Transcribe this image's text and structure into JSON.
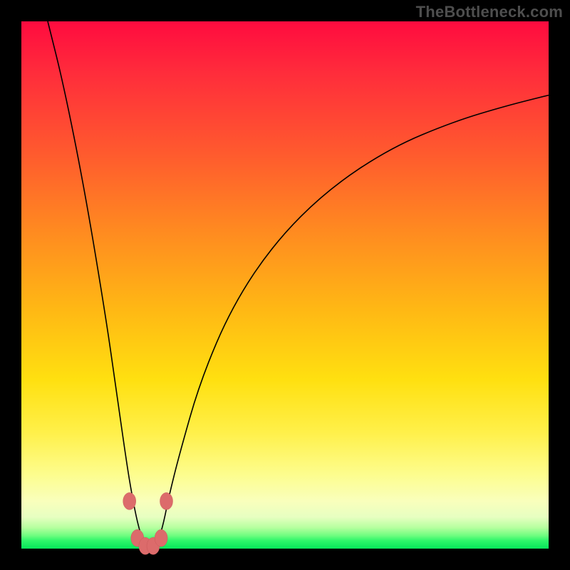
{
  "watermark": "TheBottleneck.com",
  "colors": {
    "frame": "#000000",
    "curve": "#000000",
    "marker": "#dc6b6b",
    "gradient_top": "#ff0b3f",
    "gradient_bottom": "#06e65a"
  },
  "chart_data": {
    "type": "line",
    "title": "",
    "xlabel": "",
    "ylabel": "",
    "xlim": [
      0,
      100
    ],
    "ylim": [
      0,
      100
    ],
    "note": "V-shaped bottleneck curve. y≈0 near optimum at x≈24; rises steeply on both sides. Background gradient: red (high bottleneck) at top → green (low) at bottom.",
    "series": [
      {
        "name": "bottleneck-curve",
        "x": [
          5,
          8,
          12,
          16,
          18,
          20,
          21,
          22,
          23,
          24,
          25,
          26,
          27,
          28,
          30,
          34,
          40,
          48,
          58,
          70,
          82,
          92,
          100
        ],
        "y": [
          100,
          88,
          68,
          44,
          30,
          16,
          10,
          5,
          1.5,
          0,
          0,
          1.5,
          5,
          10,
          18,
          32,
          46,
          58,
          68,
          76,
          81,
          84,
          86
        ]
      }
    ],
    "markers": [
      {
        "x": 20.5,
        "y": 9
      },
      {
        "x": 27.5,
        "y": 9
      },
      {
        "x": 22,
        "y": 2
      },
      {
        "x": 23.5,
        "y": 0.5
      },
      {
        "x": 25,
        "y": 0.5
      },
      {
        "x": 26.5,
        "y": 2
      }
    ]
  }
}
